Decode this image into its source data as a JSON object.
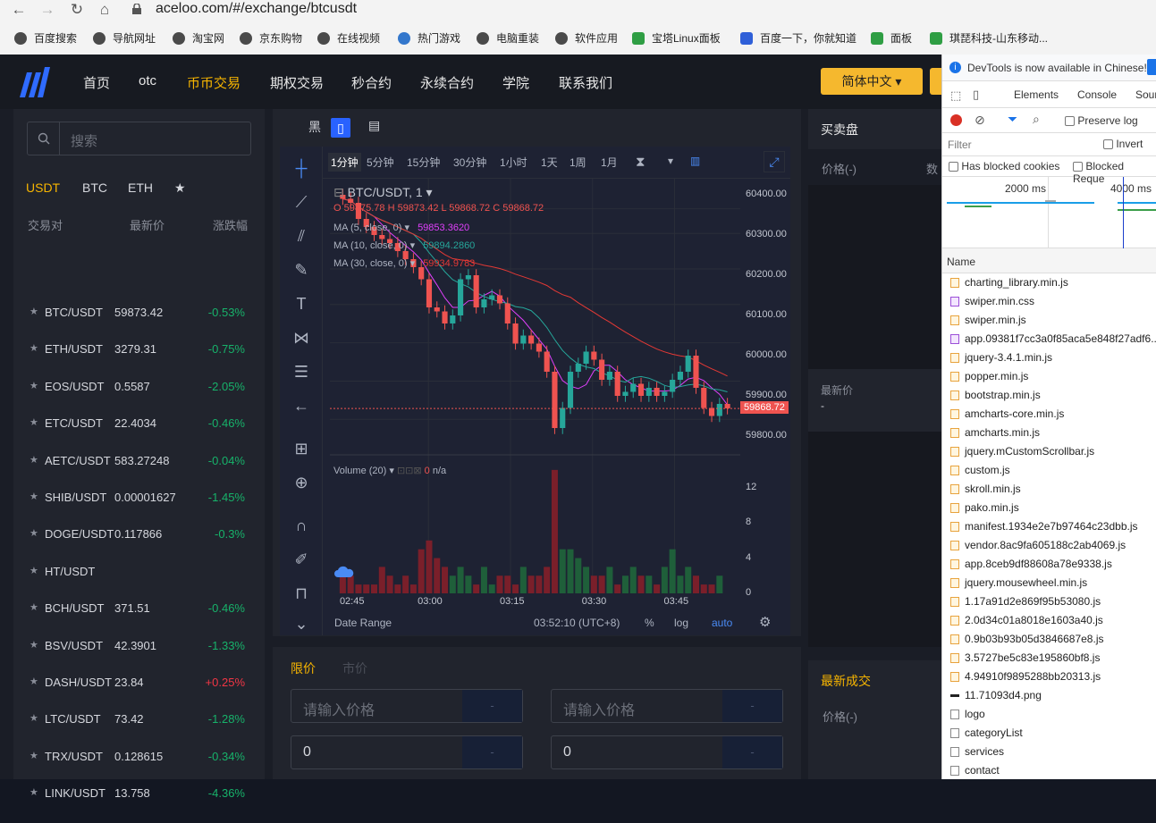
{
  "browser": {
    "url": "aceloo.com/#/exchange/btcusdt",
    "bookmarks": [
      "百度搜索",
      "导航网址",
      "淘宝网",
      "京东购物",
      "在线视频",
      "热门游戏",
      "电脑重装",
      "软件应用",
      "宝塔Linux面板",
      "百度一下，你就知道",
      "面板",
      "琪琵科技-山东移动..."
    ]
  },
  "nav": {
    "items": [
      "首页",
      "otc",
      "币币交易",
      "期权交易",
      "秒合约",
      "永续合约",
      "学院",
      "联系我们"
    ],
    "active": "币币交易",
    "language": "简体中文 ▾"
  },
  "market": {
    "search_placeholder": "搜索",
    "tabs": [
      "USDT",
      "BTC",
      "ETH",
      "★"
    ],
    "columns": [
      "交易对",
      "最新价",
      "涨跌幅"
    ],
    "rows": [
      {
        "pair": "BTC/USDT",
        "price": "59873.42",
        "change": "-0.53%"
      },
      {
        "pair": "ETH/USDT",
        "price": "3279.31",
        "change": "-0.75%"
      },
      {
        "pair": "EOS/USDT",
        "price": "0.5587",
        "change": "-2.05%"
      },
      {
        "pair": "ETC/USDT",
        "price": "22.4034",
        "change": "-0.46%"
      },
      {
        "pair": "AETC/USDT",
        "price": "583.27248",
        "change": "-0.04%"
      },
      {
        "pair": "SHIB/USDT",
        "price": "0.00001627",
        "change": "-1.45%"
      },
      {
        "pair": "DOGE/USDT",
        "price": "0.117866",
        "change": "-0.3%"
      },
      {
        "pair": "HT/USDT",
        "price": "",
        "change": ""
      },
      {
        "pair": "BCH/USDT",
        "price": "371.51",
        "change": "-0.46%"
      },
      {
        "pair": "BSV/USDT",
        "price": "42.3901",
        "change": "-1.33%"
      },
      {
        "pair": "DASH/USDT",
        "price": "23.84",
        "change": "+0.25%"
      },
      {
        "pair": "LTC/USDT",
        "price": "73.42",
        "change": "-1.28%"
      },
      {
        "pair": "TRX/USDT",
        "price": "0.128615",
        "change": "-0.34%"
      },
      {
        "pair": "LINK/USDT",
        "price": "13.758",
        "change": "-4.36%"
      }
    ]
  },
  "chart": {
    "theme_label": "黑",
    "intervals": [
      "1分钟",
      "5分钟",
      "15分钟",
      "30分钟",
      "1小时",
      "1天",
      "1周",
      "1月"
    ],
    "active_interval": "1分钟",
    "symbol": "BTC/USDT, 1",
    "ohlc": {
      "o": "59875.78",
      "h": "59873.42",
      "l": "59868.72",
      "c": "59868.72"
    },
    "ma5": {
      "label": "MA (5, close, 0)",
      "value": "59853.3620",
      "color": "#e040fb"
    },
    "ma10": {
      "label": "MA (10, close, 0)",
      "value": "59894.2860",
      "color": "#26a69a"
    },
    "ma30": {
      "label": "MA (30, close, 0)",
      "value": "59934.9783",
      "color": "#e53935"
    },
    "last_price": "59868.72",
    "price_ticks": [
      "60400.00",
      "60300.00",
      "60200.00",
      "60100.00",
      "60000.00",
      "59900.00",
      "59800.00"
    ],
    "volume_label": "Volume (20)",
    "volume_value": "0",
    "volume_na": "n/a",
    "volume_ticks": [
      "12",
      "8",
      "4",
      "0"
    ],
    "time_ticks": [
      "02:45",
      "03:00",
      "03:15",
      "03:30",
      "03:45"
    ],
    "date_range": "Date Range",
    "clock": "03:52:10 (UTC+8)",
    "percent": "%",
    "log": "log",
    "auto": "auto"
  },
  "chart_data": {
    "type": "candlestick",
    "x_start": "02:45",
    "interval": "1m",
    "open": [
      60400,
      60390,
      60380,
      60340,
      60320,
      60300,
      60290,
      60280,
      60260,
      60240,
      60220,
      60190,
      60120,
      60110,
      60080,
      60100,
      60190,
      60200,
      60120,
      60140,
      60150,
      60130,
      60080,
      60030,
      60050,
      60030,
      60010,
      59960,
      59820,
      59870,
      59960,
      59980,
      60010,
      59990,
      59940,
      59960,
      59900,
      59910,
      59930,
      59900,
      59920,
      59900,
      59910,
      59940,
      59960,
      60000,
      59920,
      59870,
      59850,
      59880
    ],
    "close": [
      60390,
      60380,
      60340,
      60320,
      60300,
      60290,
      60280,
      60260,
      60240,
      60220,
      60190,
      60120,
      60110,
      60080,
      60100,
      60190,
      60200,
      60120,
      60140,
      60150,
      60130,
      60080,
      60030,
      60050,
      60030,
      60010,
      59960,
      59820,
      59870,
      59960,
      59980,
      60010,
      59990,
      59940,
      59960,
      59900,
      59910,
      59930,
      59900,
      59920,
      59900,
      59910,
      59940,
      59960,
      60000,
      59920,
      59870,
      59850,
      59880,
      59869
    ],
    "volume": [
      2,
      2,
      1,
      1,
      1,
      3,
      2,
      1,
      2,
      1,
      5,
      6,
      4,
      3,
      2,
      3,
      2,
      1,
      3,
      1,
      2,
      2,
      1,
      3,
      2,
      2,
      3,
      14,
      5,
      5,
      4,
      3,
      2,
      2,
      3,
      1,
      2,
      3,
      2,
      2,
      1,
      3,
      5,
      2,
      3,
      2,
      1,
      1,
      2,
      0
    ],
    "ylim": [
      59760,
      60440
    ],
    "volume_ylim": [
      0,
      15
    ]
  },
  "order": {
    "tabs": [
      "限价",
      "市价"
    ],
    "price_placeholder": "请输入价格",
    "amount_value": "0",
    "suffix": "-"
  },
  "orderbook": {
    "title": "买卖盘",
    "price_col": "价格(-)",
    "amount_col": "数",
    "latest_label": "最新价",
    "latest_value": "-"
  },
  "trades": {
    "title": "最新成交",
    "price_col": "价格(-)"
  },
  "devtools": {
    "banner": "DevTools is now available in Chinese!",
    "tabs": [
      "Elements",
      "Console",
      "Sour"
    ],
    "preserve_log": "Preserve log",
    "filter": "Filter",
    "invert": "Invert",
    "has_blocked": "Has blocked cookies",
    "blocked_req": "Blocked Reque",
    "timeline": [
      "2000 ms",
      "4000 ms"
    ],
    "name_header": "Name",
    "files": [
      {
        "name": "charting_library.min.js",
        "kind": "js"
      },
      {
        "name": "swiper.min.css",
        "kind": "css"
      },
      {
        "name": "swiper.min.js",
        "kind": "js"
      },
      {
        "name": "app.09381f7cc3a0f85aca5e848f27adf6...",
        "kind": "css"
      },
      {
        "name": "jquery-3.4.1.min.js",
        "kind": "js"
      },
      {
        "name": "popper.min.js",
        "kind": "js"
      },
      {
        "name": "bootstrap.min.js",
        "kind": "js"
      },
      {
        "name": "amcharts-core.min.js",
        "kind": "js"
      },
      {
        "name": "amcharts.min.js",
        "kind": "js"
      },
      {
        "name": "jquery.mCustomScrollbar.js",
        "kind": "js"
      },
      {
        "name": "custom.js",
        "kind": "js"
      },
      {
        "name": "skroll.min.js",
        "kind": "js"
      },
      {
        "name": "pako.min.js",
        "kind": "js"
      },
      {
        "name": "manifest.1934e2e7b97464c23dbb.js",
        "kind": "js"
      },
      {
        "name": "vendor.8ac9fa605188c2ab4069.js",
        "kind": "js"
      },
      {
        "name": "app.8ceb9df88608a78e9338.js",
        "kind": "js"
      },
      {
        "name": "jquery.mousewheel.min.js",
        "kind": "js"
      },
      {
        "name": "1.17a91d2e869f95b53080.js",
        "kind": "js"
      },
      {
        "name": "2.0d34c01a8018e1603a40.js",
        "kind": "js"
      },
      {
        "name": "0.9b03b93b05d3846687e8.js",
        "kind": "js"
      },
      {
        "name": "3.5727be5c83e195860bf8.js",
        "kind": "js"
      },
      {
        "name": "4.94910f9895288bb20313.js",
        "kind": "js"
      },
      {
        "name": "11.71093d4.png",
        "kind": "img"
      },
      {
        "name": "logo",
        "kind": "doc"
      },
      {
        "name": "categoryList",
        "kind": "doc"
      },
      {
        "name": "services",
        "kind": "doc"
      },
      {
        "name": "contact",
        "kind": "doc"
      }
    ]
  },
  "colors": {
    "accent": "#f7b500",
    "up": "#26a69a",
    "down": "#ef5350",
    "brand": "#2962ff"
  }
}
